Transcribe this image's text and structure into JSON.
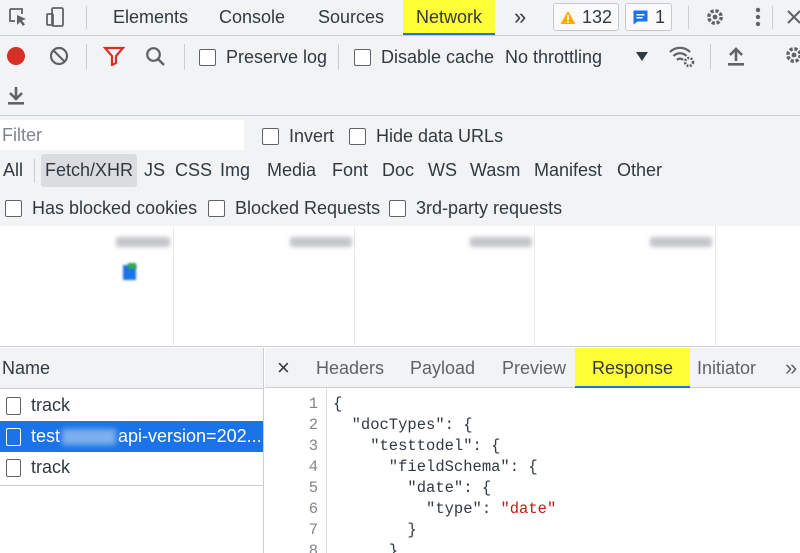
{
  "tabbar": {
    "tabs": [
      "Elements",
      "Console",
      "Sources",
      "Network"
    ],
    "active_tab": "Network",
    "more_tabs": "»",
    "warnings_count": "132",
    "messages_count": "1"
  },
  "toolbar": {
    "preserve_log_label": "Preserve log",
    "disable_cache_label": "Disable cache",
    "throttling_value": "No throttling"
  },
  "filter": {
    "placeholder": "Filter",
    "invert_label": "Invert",
    "hide_data_urls_label": "Hide data URLs",
    "types": [
      "All",
      "Fetch/XHR",
      "JS",
      "CSS",
      "Img",
      "Media",
      "Font",
      "Doc",
      "WS",
      "Wasm",
      "Manifest",
      "Other"
    ],
    "selected_type": "Fetch/XHR",
    "has_blocked_cookies_label": "Has blocked cookies",
    "blocked_requests_label": "Blocked Requests",
    "third_party_label": "3rd-party requests"
  },
  "requests": {
    "column_header": "Name",
    "rows": [
      {
        "name": "track"
      },
      {
        "name_prefix": "test",
        "name_suffix": "api-version=202..."
      },
      {
        "name": "track"
      }
    ]
  },
  "details": {
    "close": "×",
    "tabs": [
      "Headers",
      "Payload",
      "Preview",
      "Response",
      "Initiator"
    ],
    "active_tab": "Response",
    "more": "»"
  },
  "response": {
    "line_numbers": [
      "1",
      "2",
      "3",
      "4",
      "5",
      "6",
      "7",
      "8"
    ],
    "lines": [
      "{",
      "  \"docTypes\": {",
      "    \"testtodel\": {",
      "      \"fieldSchema\": {",
      "        \"date\": {",
      "          \"type\": ",
      "        }",
      "      }"
    ],
    "string_value": "\"date\""
  },
  "colors": {
    "highlight": "#ffff35",
    "accent": "#1a73e8",
    "record": "#d93025",
    "filter_funnel": "#d93025",
    "warning": "#f9ab00",
    "string": "#c41a16"
  },
  "icons": [
    "inspect-icon",
    "device-toggle-icon",
    "more-tabs-icon",
    "warning-icon",
    "message-icon",
    "gear-icon",
    "kebab-menu-icon",
    "record-icon",
    "clear-icon",
    "filter-funnel-icon",
    "search-icon",
    "dropdown-arrow-icon",
    "network-conditions-icon",
    "import-har-icon",
    "export-har-icon",
    "settings-gear-icon",
    "close-icon",
    "file-icon"
  ]
}
